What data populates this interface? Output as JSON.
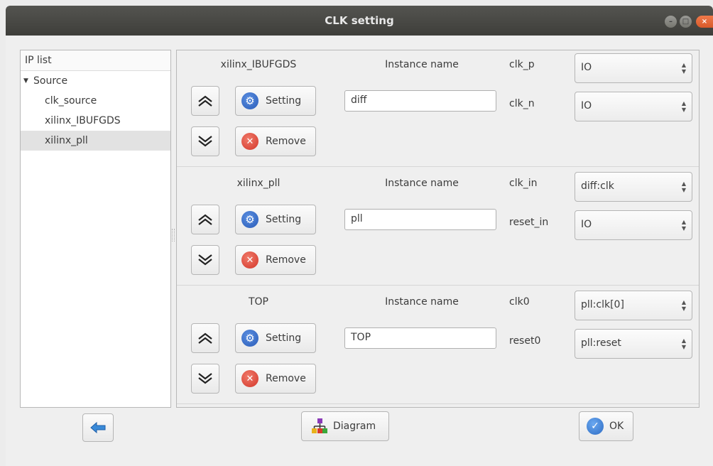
{
  "window": {
    "title": "CLK setting"
  },
  "tree": {
    "header": "IP list",
    "root": "Source",
    "items": [
      "clk_source",
      "xilinx_IBUFGDS",
      "xilinx_pll"
    ]
  },
  "blocks": [
    {
      "ip": "xilinx_IBUFGDS",
      "instance_label": "Instance name",
      "instance_value": "diff",
      "pins": [
        {
          "label": "clk_p",
          "value": "IO"
        },
        {
          "label": "clk_n",
          "value": "IO"
        }
      ],
      "setting_label": "Setting",
      "remove_label": "Remove"
    },
    {
      "ip": "xilinx_pll",
      "instance_label": "Instance name",
      "instance_value": "pll",
      "pins": [
        {
          "label": "clk_in",
          "value": "diff:clk"
        },
        {
          "label": "reset_in",
          "value": "IO"
        }
      ],
      "setting_label": "Setting",
      "remove_label": "Remove"
    },
    {
      "ip": "TOP",
      "instance_label": "Instance name",
      "instance_value": "TOP",
      "pins": [
        {
          "label": "clk0",
          "value": "pll:clk[0]"
        },
        {
          "label": "reset0",
          "value": "pll:reset"
        }
      ],
      "setting_label": "Setting",
      "remove_label": "Remove"
    }
  ],
  "footer": {
    "diagram_label": "Diagram",
    "ok_label": "OK"
  },
  "icons": {
    "up": "double-chevron-up-icon",
    "down": "double-chevron-down-icon",
    "setting": "gear-icon",
    "remove": "remove-icon",
    "back": "back-arrow-icon",
    "diagram": "diagram-icon",
    "ok": "check-icon"
  },
  "colors": {
    "titlebar": "#4a4a46",
    "selection": "#e2e2e2",
    "gear": "#2a5cb8",
    "remove": "#d3362a",
    "ok": "#2e6cc4"
  }
}
